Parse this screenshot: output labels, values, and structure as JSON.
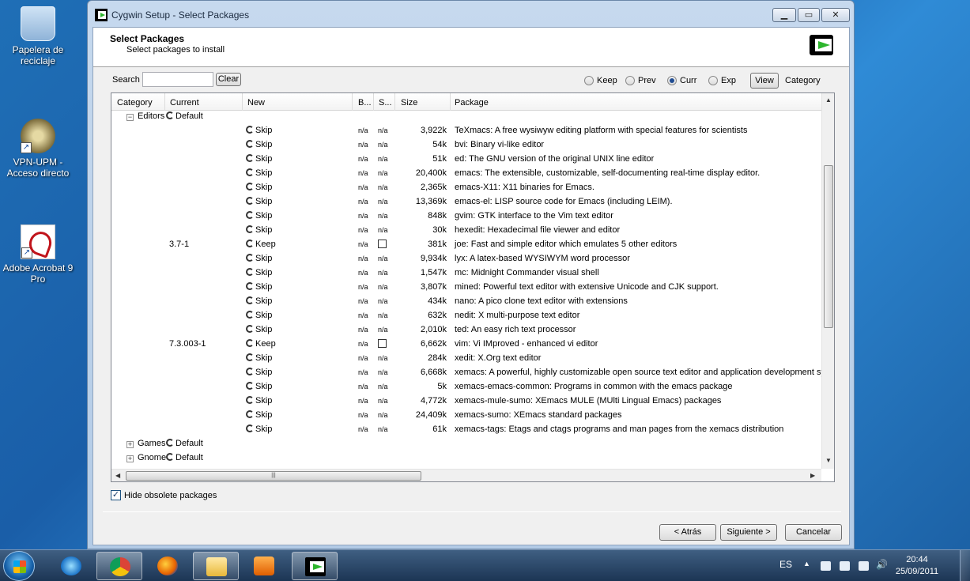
{
  "desktop": {
    "icons": [
      {
        "label": "Papelera de reciclaje"
      },
      {
        "label": "VPN-UPM - Acceso directo"
      },
      {
        "label": "Adobe Acrobat 9 Pro"
      }
    ]
  },
  "window": {
    "title": "Cygwin Setup - Select Packages",
    "header_title": "Select Packages",
    "header_subtitle": "Select packages to install",
    "search_label": "Search",
    "search_value": "",
    "clear_label": "Clear",
    "view_options": [
      "Keep",
      "Prev",
      "Curr",
      "Exp"
    ],
    "view_selected": "Curr",
    "view_button": "View",
    "view_mode": "Category",
    "columns": [
      "Category",
      "Current",
      "New",
      "B...",
      "S...",
      "Size",
      "Package"
    ],
    "editors_group": {
      "name": "Editors",
      "setting": "Default"
    },
    "packages": [
      {
        "current": "",
        "new": "Skip",
        "b": "n/a",
        "s": "n/a",
        "s_checkbox": false,
        "size": "3,922k",
        "package": "TeXmacs: A free wysiwyw editing platform with special features for scientists"
      },
      {
        "current": "",
        "new": "Skip",
        "b": "n/a",
        "s": "n/a",
        "s_checkbox": false,
        "size": "54k",
        "package": "bvi: Binary vi-like editor"
      },
      {
        "current": "",
        "new": "Skip",
        "b": "n/a",
        "s": "n/a",
        "s_checkbox": false,
        "size": "51k",
        "package": "ed: The GNU version of the original UNIX line editor"
      },
      {
        "current": "",
        "new": "Skip",
        "b": "n/a",
        "s": "n/a",
        "s_checkbox": false,
        "size": "20,400k",
        "package": "emacs: The extensible, customizable, self-documenting real-time display editor."
      },
      {
        "current": "",
        "new": "Skip",
        "b": "n/a",
        "s": "n/a",
        "s_checkbox": false,
        "size": "2,365k",
        "package": "emacs-X11: X11 binaries for Emacs."
      },
      {
        "current": "",
        "new": "Skip",
        "b": "n/a",
        "s": "n/a",
        "s_checkbox": false,
        "size": "13,369k",
        "package": "emacs-el: LISP source code for Emacs (including LEIM)."
      },
      {
        "current": "",
        "new": "Skip",
        "b": "n/a",
        "s": "n/a",
        "s_checkbox": false,
        "size": "848k",
        "package": "gvim: GTK interface to the Vim text editor"
      },
      {
        "current": "",
        "new": "Skip",
        "b": "n/a",
        "s": "n/a",
        "s_checkbox": false,
        "size": "30k",
        "package": "hexedit: Hexadecimal file viewer and editor"
      },
      {
        "current": "3.7-1",
        "new": "Keep",
        "b": "n/a",
        "s": "",
        "s_checkbox": true,
        "size": "381k",
        "package": "joe: Fast and simple editor which emulates 5 other editors"
      },
      {
        "current": "",
        "new": "Skip",
        "b": "n/a",
        "s": "n/a",
        "s_checkbox": false,
        "size": "9,934k",
        "package": "lyx: A latex-based WYSIWYM word processor"
      },
      {
        "current": "",
        "new": "Skip",
        "b": "n/a",
        "s": "n/a",
        "s_checkbox": false,
        "size": "1,547k",
        "package": "mc: Midnight Commander visual shell"
      },
      {
        "current": "",
        "new": "Skip",
        "b": "n/a",
        "s": "n/a",
        "s_checkbox": false,
        "size": "3,807k",
        "package": "mined: Powerful text editor with extensive Unicode and CJK support."
      },
      {
        "current": "",
        "new": "Skip",
        "b": "n/a",
        "s": "n/a",
        "s_checkbox": false,
        "size": "434k",
        "package": "nano: A pico clone text editor with extensions"
      },
      {
        "current": "",
        "new": "Skip",
        "b": "n/a",
        "s": "n/a",
        "s_checkbox": false,
        "size": "632k",
        "package": "nedit: X multi-purpose text editor"
      },
      {
        "current": "",
        "new": "Skip",
        "b": "n/a",
        "s": "n/a",
        "s_checkbox": false,
        "size": "2,010k",
        "package": "ted: An easy rich text processor"
      },
      {
        "current": "7.3.003-1",
        "new": "Keep",
        "b": "n/a",
        "s": "",
        "s_checkbox": true,
        "size": "6,662k",
        "package": "vim: Vi IMproved - enhanced vi editor"
      },
      {
        "current": "",
        "new": "Skip",
        "b": "n/a",
        "s": "n/a",
        "s_checkbox": false,
        "size": "284k",
        "package": "xedit: X.Org text editor"
      },
      {
        "current": "",
        "new": "Skip",
        "b": "n/a",
        "s": "n/a",
        "s_checkbox": false,
        "size": "6,668k",
        "package": "xemacs: A powerful, highly customizable open source text editor and application development syste"
      },
      {
        "current": "",
        "new": "Skip",
        "b": "n/a",
        "s": "n/a",
        "s_checkbox": false,
        "size": "5k",
        "package": "xemacs-emacs-common: Programs in common with the emacs package"
      },
      {
        "current": "",
        "new": "Skip",
        "b": "n/a",
        "s": "n/a",
        "s_checkbox": false,
        "size": "4,772k",
        "package": "xemacs-mule-sumo: XEmacs MULE (MUlti Lingual Emacs) packages"
      },
      {
        "current": "",
        "new": "Skip",
        "b": "n/a",
        "s": "n/a",
        "s_checkbox": false,
        "size": "24,409k",
        "package": "xemacs-sumo: XEmacs standard packages"
      },
      {
        "current": "",
        "new": "Skip",
        "b": "n/a",
        "s": "n/a",
        "s_checkbox": false,
        "size": "61k",
        "package": "xemacs-tags: Etags and ctags programs and man pages from the xemacs distribution"
      }
    ],
    "collapsed_groups": [
      {
        "name": "Games",
        "setting": "Default"
      },
      {
        "name": "Gnome",
        "setting": "Default"
      }
    ],
    "hide_obsolete_label": "Hide obsolete packages",
    "hide_obsolete_checked": true,
    "back_label": "< Atrás",
    "next_label": "Siguiente >",
    "cancel_label": "Cancelar"
  },
  "taskbar": {
    "language": "ES",
    "time": "20:44",
    "date": "25/09/2011"
  }
}
